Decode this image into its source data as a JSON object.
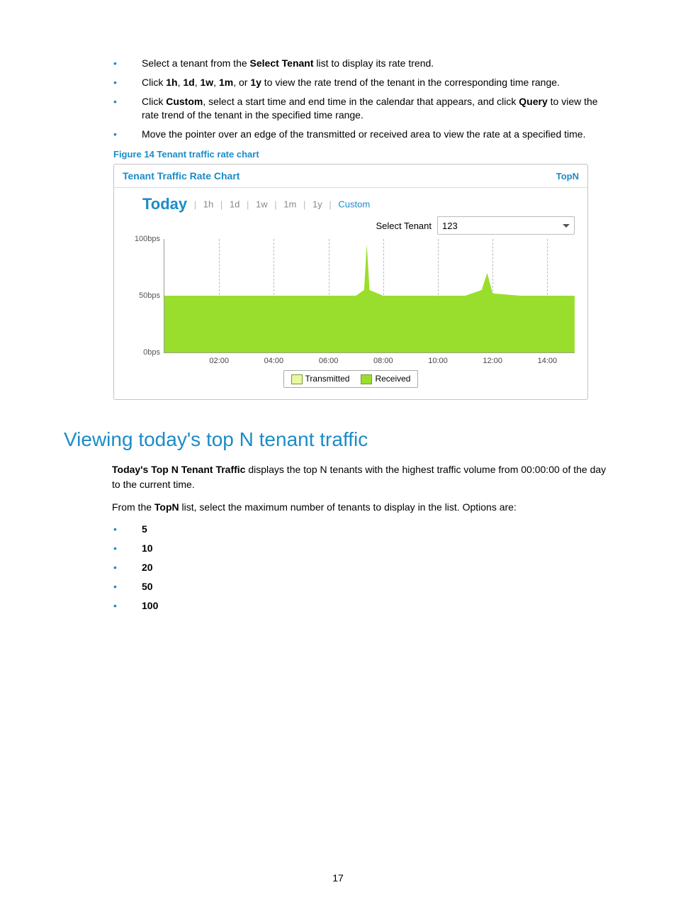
{
  "bullets": [
    {
      "pre": "Select a tenant from the ",
      "b": "Select Tenant",
      "post": " list to display its rate trend."
    },
    {
      "raw": "Click <b>1h</b>, <b>1d</b>, <b>1w</b>, <b>1m</b>, or <b>1y</b> to view the rate trend of the tenant in the corresponding time range."
    },
    {
      "raw": "Click <b>Custom</b>, select a start time and end time in the calendar that appears, and click <b>Query</b> to view the rate trend of the tenant in the specified time range."
    },
    {
      "pre": "Move the pointer over an edge of the transmitted or received area to view the rate at a specified time.",
      "b": "",
      "post": ""
    }
  ],
  "figure_caption": "Figure 14 Tenant traffic rate chart",
  "panel": {
    "title": "Tenant Traffic Rate Chart",
    "topn": "TopN",
    "active_tab": "Today",
    "tabs": [
      "1h",
      "1d",
      "1w",
      "1m",
      "1y",
      "Custom"
    ],
    "tenant_label": "Select Tenant",
    "tenant_value": "123"
  },
  "chart_data": {
    "type": "area",
    "title": "Tenant Traffic Rate Chart",
    "xlabel": "",
    "ylabel": "",
    "ylim": [
      0,
      100
    ],
    "y_unit": "bps",
    "y_ticks": [
      0,
      50,
      100
    ],
    "x_ticks": [
      "02:00",
      "04:00",
      "06:00",
      "08:00",
      "10:00",
      "12:00",
      "14:00"
    ],
    "series": [
      {
        "name": "Transmitted",
        "color": "#e8f8a0",
        "x": [
          0,
          1,
          2,
          3,
          4,
          5,
          6,
          7,
          7.3,
          7.4,
          7.5,
          8,
          9,
          10,
          11,
          11.6,
          11.8,
          12,
          13,
          14,
          15
        ],
        "y": [
          50,
          50,
          50,
          50,
          50,
          50,
          50,
          50,
          55,
          95,
          55,
          50,
          50,
          50,
          50,
          55,
          70,
          52,
          50,
          50,
          50
        ]
      },
      {
        "name": "Received",
        "color": "#9ade2d",
        "x": [
          0,
          1,
          2,
          3,
          4,
          5,
          6,
          7,
          7.3,
          7.4,
          7.5,
          8,
          9,
          10,
          11,
          11.6,
          11.8,
          12,
          13,
          14,
          15
        ],
        "y": [
          50,
          50,
          50,
          50,
          50,
          50,
          50,
          50,
          55,
          95,
          55,
          50,
          50,
          50,
          50,
          55,
          70,
          52,
          50,
          50,
          50
        ]
      }
    ],
    "legend": [
      "Transmitted",
      "Received"
    ]
  },
  "section_heading": "Viewing today's top N tenant traffic",
  "para1": {
    "b": "Today's Top N Tenant Traffic",
    "rest": " displays the top N tenants with the highest traffic volume from 00:00:00 of the day to the current time."
  },
  "para2": {
    "pre": "From the ",
    "b": "TopN",
    "post": " list, select the maximum number of tenants to display in the list. Options are:"
  },
  "options": [
    "5",
    "10",
    "20",
    "50",
    "100"
  ],
  "page_number": "17"
}
